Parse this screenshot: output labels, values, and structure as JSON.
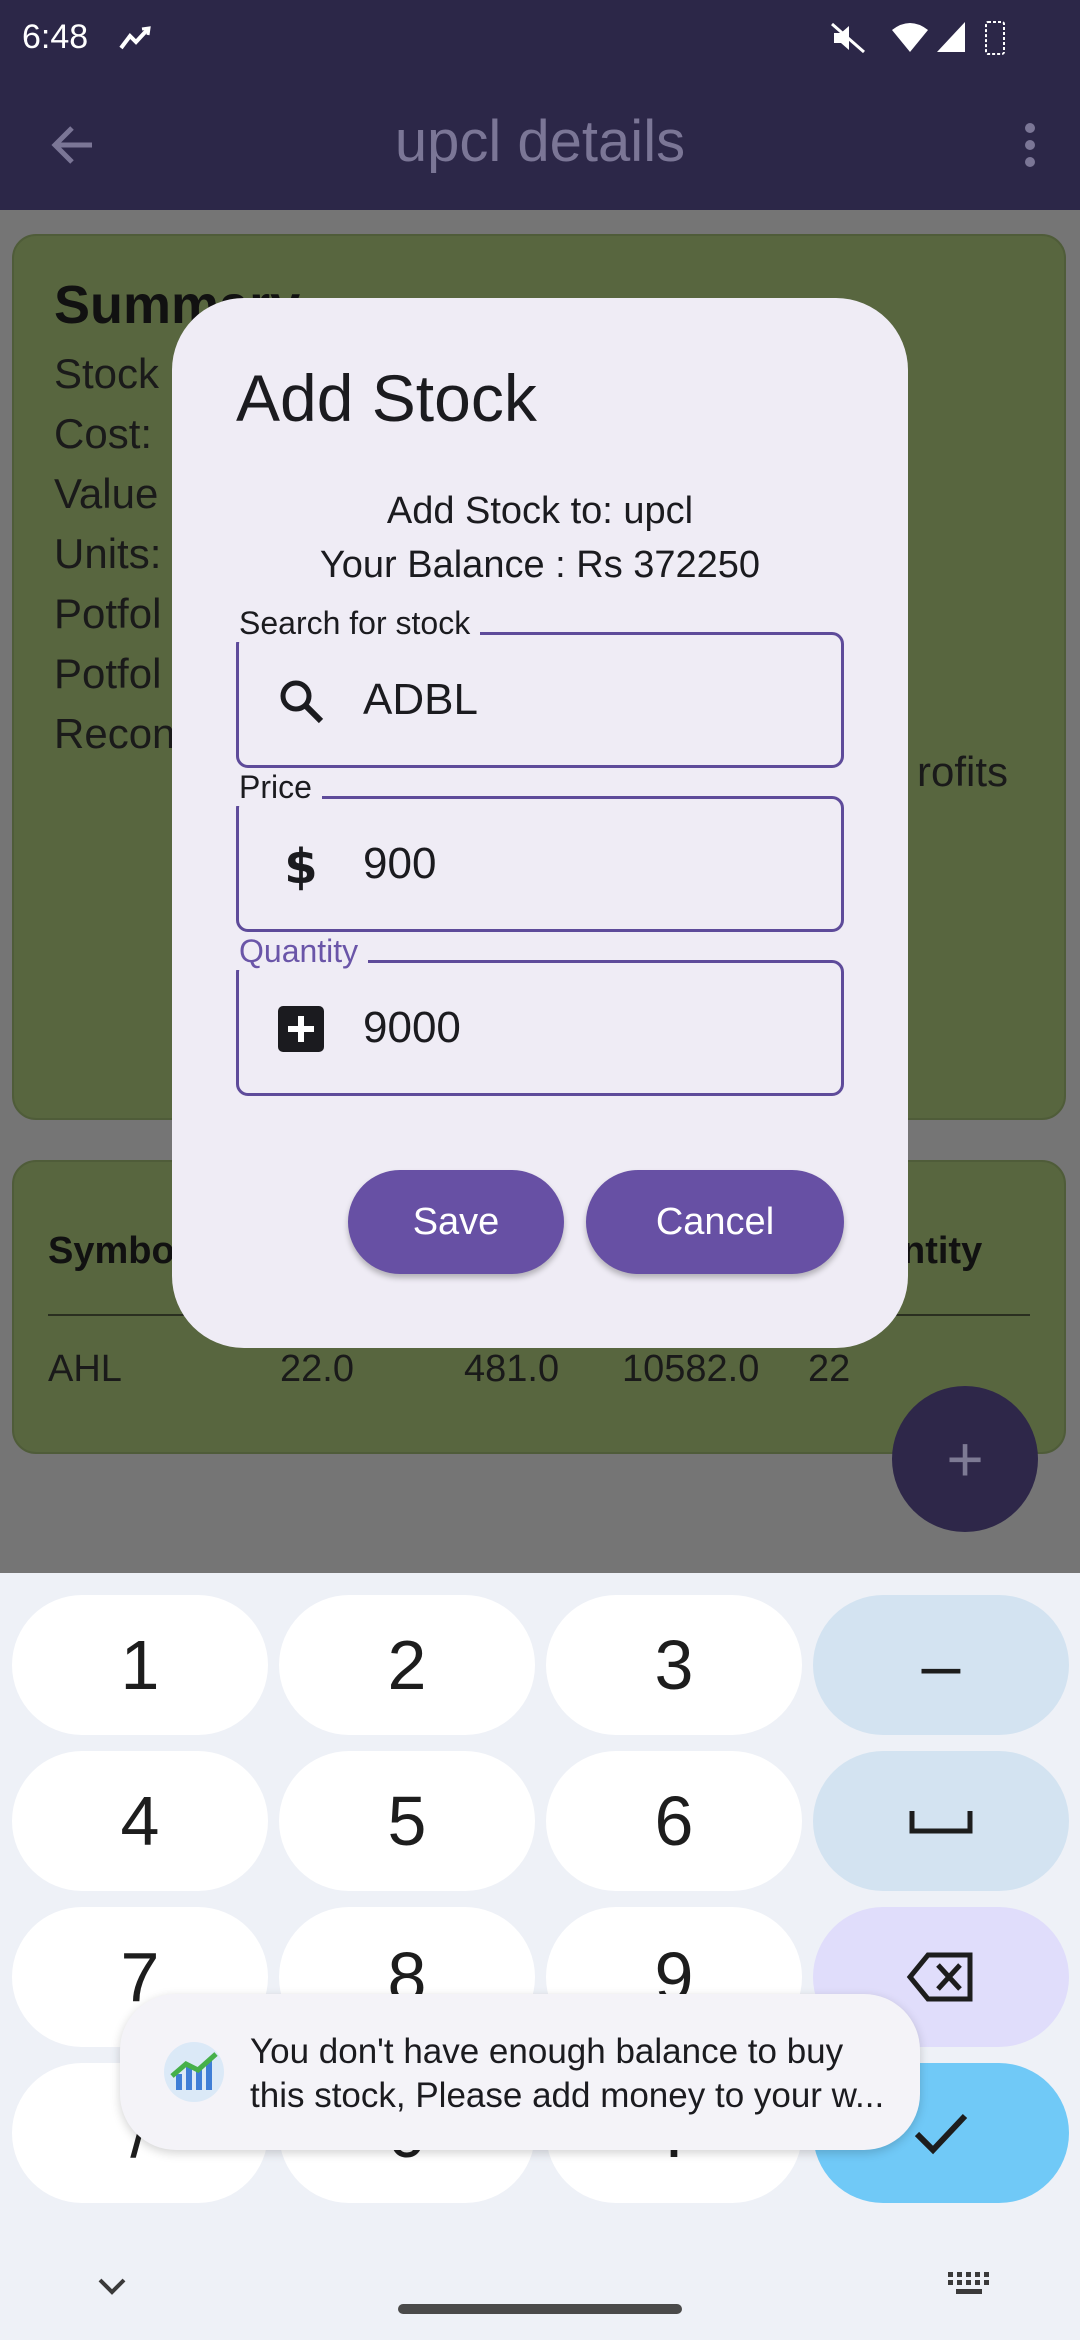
{
  "status_bar": {
    "time": "6:48"
  },
  "app_bar": {
    "title": "upcl details"
  },
  "summary": {
    "title": "Summary",
    "lines": [
      "Stock",
      "Cost:",
      "Value",
      "Units:",
      "Potfol",
      "Potfol",
      "Recon"
    ],
    "right_text": "rofits"
  },
  "holdings_table": {
    "headers": [
      "Symbo",
      "ntity"
    ],
    "row": [
      "AHL",
      "22.0",
      "481.0",
      "10582.0",
      "22"
    ]
  },
  "dialog": {
    "title": "Add Stock",
    "add_to_label": "Add Stock to:  upcl",
    "balance_label": "Your Balance : Rs 372250",
    "search": {
      "label": "Search for stock",
      "value": "ADBL"
    },
    "price": {
      "label": "Price",
      "value": "900"
    },
    "quantity": {
      "label": "Quantity",
      "value": "9000"
    },
    "save_label": "Save",
    "cancel_label": "Cancel"
  },
  "keyboard": {
    "keys": [
      "1",
      "2",
      "3",
      "4",
      "5",
      "6",
      "7",
      "8",
      "9",
      "/",
      "0",
      "."
    ],
    "minus_key": "–"
  },
  "toast": {
    "message": "You don't have enough balance to buy this stock, Please add money to your w..."
  },
  "colors": {
    "app_bar": "#2c2748",
    "accent": "#6750a4",
    "card": "#58663f",
    "enter_key": "#70c9f7"
  }
}
